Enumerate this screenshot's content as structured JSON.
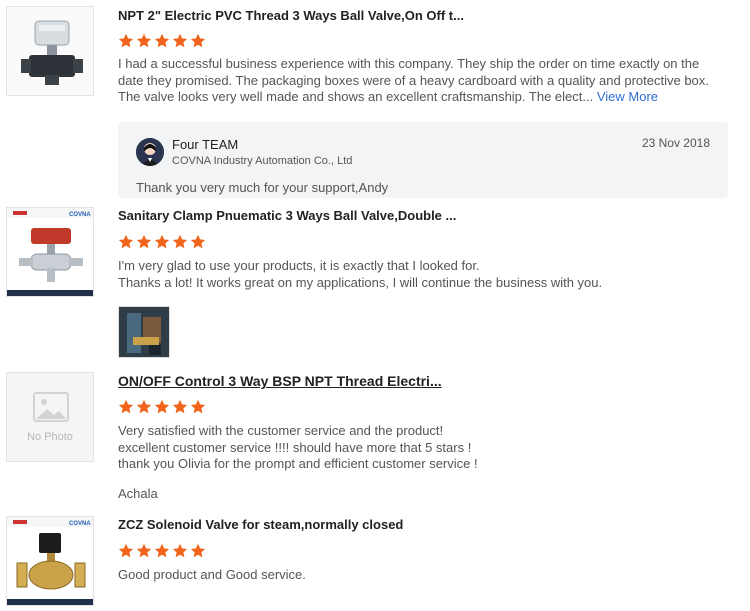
{
  "reviews": [
    {
      "title": "NPT 2\" Electric PVC Thread 3 Ways Ball Valve,On Off t...",
      "rating": 5,
      "text": "I had a successful business experience with this company. They ship the order on time exactly on the date they promised. The packaging boxes were of a heavy cardboard with a quality and protective box. The valve looks very well made and shows an excellent craftsmanship. The elect...",
      "view_more": "View More",
      "reply": {
        "name": "Four TEAM",
        "company": "COVNA Industry Automation Co., Ltd",
        "date": "23 Nov 2018",
        "text": "Thank you very much for your support,Andy"
      }
    },
    {
      "title": "Sanitary Clamp Pnuematic 3 Ways Ball Valve,Double ...",
      "rating": 5,
      "lines": [
        "I'm very glad to use your products, it is exactly that I looked for.",
        "Thanks a lot! It works great on my applications, I will continue the business with you."
      ],
      "brand": "COVNA"
    },
    {
      "title": "ON/OFF Control 3 Way BSP NPT Thread Electri...",
      "rating": 5,
      "no_photo": "No Photo",
      "lines": [
        "Very satisfied with the customer service and the product!",
        "excellent customer service !!!! should have more that 5 stars !",
        "thank you Olivia  for the prompt and efficient customer service !"
      ],
      "author": "Achala"
    },
    {
      "title": "ZCZ Solenoid Valve for steam,normally closed",
      "rating": 5,
      "text": "Good product and Good service.",
      "brand": "COVNA"
    }
  ],
  "colors": {
    "star": "#f0641e",
    "link": "#2e6fd1",
    "reply_bg": "#f3f4f6"
  }
}
